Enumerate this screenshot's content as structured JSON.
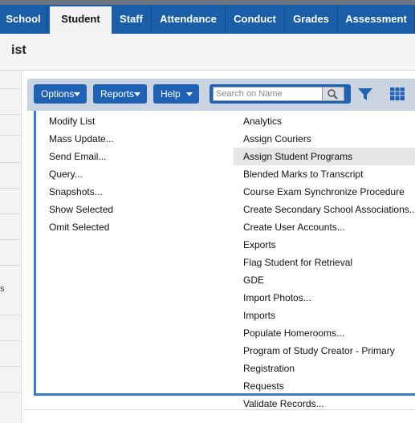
{
  "nav": {
    "tabs": [
      {
        "label": "School",
        "active": false
      },
      {
        "label": "Student",
        "active": true
      },
      {
        "label": "Staff",
        "active": false
      },
      {
        "label": "Attendance",
        "active": false
      },
      {
        "label": "Conduct",
        "active": false
      },
      {
        "label": "Grades",
        "active": false
      },
      {
        "label": "Assessment",
        "active": false
      }
    ]
  },
  "page": {
    "title": "ist",
    "left_char": "s"
  },
  "toolbar": {
    "options_label": "Options",
    "reports_label": "Reports",
    "help_label": "Help",
    "search_placeholder": "Search on Name",
    "filter_icon": "filter-icon",
    "grid_icon": "grid-icon"
  },
  "menu": {
    "left_items": [
      "Modify List",
      "Mass Update...",
      "Send Email...",
      "Query...",
      "Snapshots...",
      "Show Selected",
      "Omit Selected"
    ],
    "right_items": [
      {
        "label": "Analytics",
        "submenu": true,
        "highlighted": false
      },
      {
        "label": "Assign Couriers",
        "submenu": false,
        "highlighted": false
      },
      {
        "label": "Assign Student Programs",
        "submenu": false,
        "highlighted": true
      },
      {
        "label": "Blended Marks to Transcript",
        "submenu": false,
        "highlighted": false
      },
      {
        "label": "Course Exam Synchronize Procedure",
        "submenu": false,
        "highlighted": false
      },
      {
        "label": "Create Secondary School Associations...",
        "submenu": false,
        "highlighted": false
      },
      {
        "label": "Create User Accounts...",
        "submenu": false,
        "highlighted": false
      },
      {
        "label": "Exports",
        "submenu": true,
        "highlighted": false
      },
      {
        "label": "Flag Student for Retrieval",
        "submenu": false,
        "highlighted": false
      },
      {
        "label": "GDE",
        "submenu": true,
        "highlighted": false
      },
      {
        "label": "Import Photos...",
        "submenu": false,
        "highlighted": false
      },
      {
        "label": "Imports",
        "submenu": true,
        "highlighted": false
      },
      {
        "label": "Populate Homerooms...",
        "submenu": false,
        "highlighted": false
      },
      {
        "label": "Program of Study Creator - Primary",
        "submenu": false,
        "highlighted": false
      },
      {
        "label": "Registration",
        "submenu": true,
        "highlighted": false
      },
      {
        "label": "Requests",
        "submenu": true,
        "highlighted": false
      },
      {
        "label": "Validate Records...",
        "submenu": false,
        "highlighted": false
      }
    ]
  },
  "colors": {
    "nav_bg": "#1a5ea8",
    "button_bg": "#1f62b5",
    "toolbar_bg": "#cbd5e2",
    "menu_border": "#3a7cc8",
    "highlight": "#e6e6e6"
  }
}
